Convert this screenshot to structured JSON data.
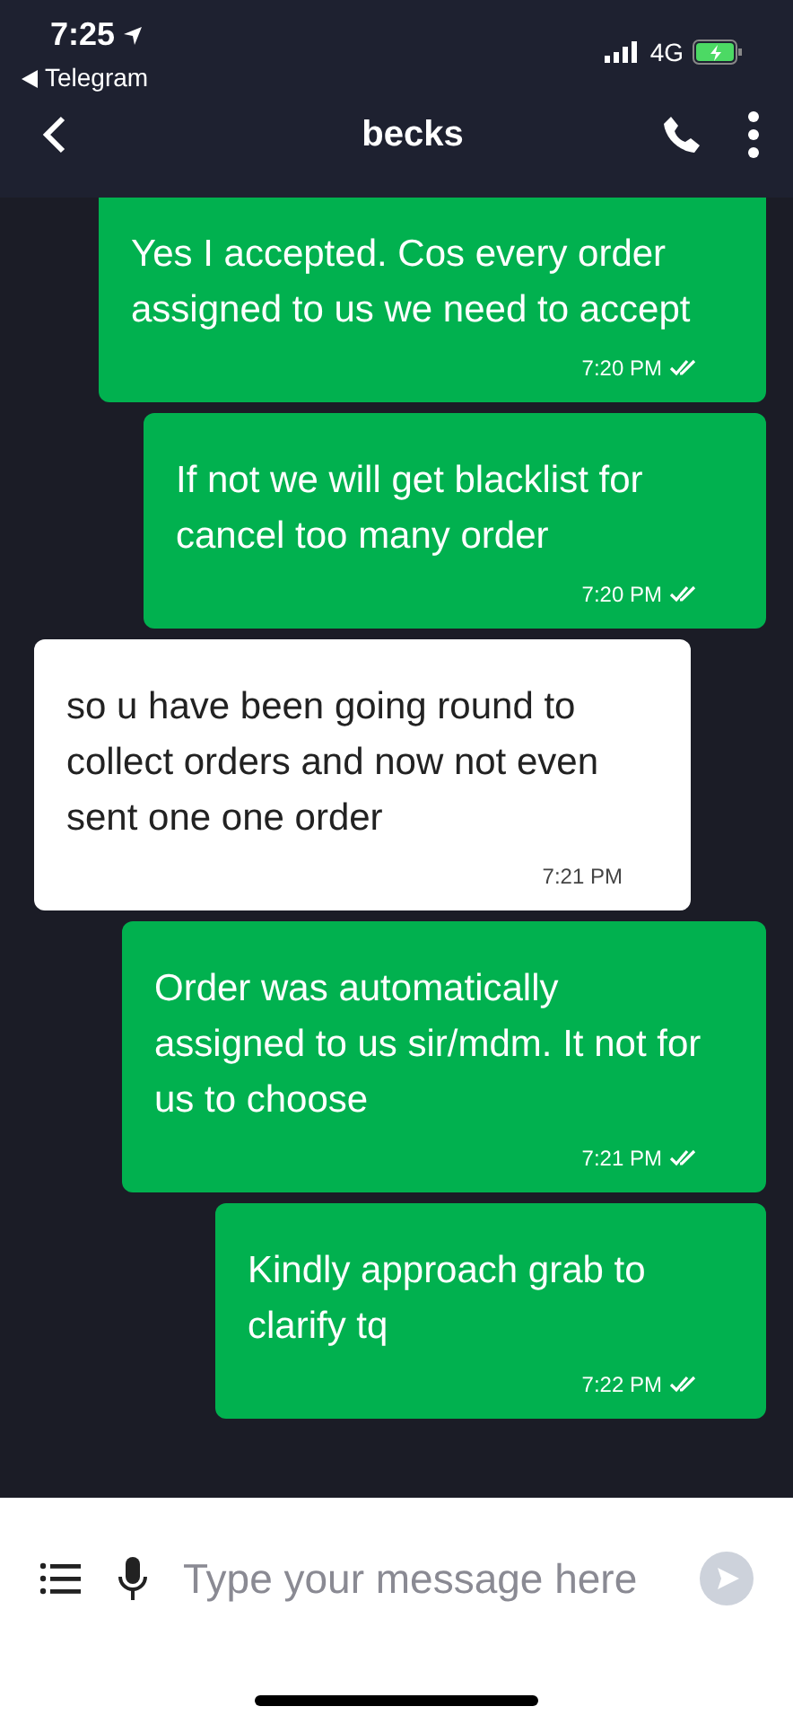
{
  "status_bar": {
    "time": "7:25",
    "back_app": "Telegram",
    "network": "4G"
  },
  "header": {
    "title": "becks"
  },
  "messages": [
    {
      "text": "Yes I accepted. Cos every order assigned to us we need to accept",
      "time": "7:20 PM",
      "outgoing": true,
      "read": true
    },
    {
      "text": "If not we will get blacklist for cancel too many order",
      "time": "7:20 PM",
      "outgoing": true,
      "read": true
    },
    {
      "text": "so u have been going round to collect orders and now not even sent one one order",
      "time": "7:21 PM",
      "outgoing": false,
      "read": false
    },
    {
      "text": "Order was automatically assigned to us sir/mdm. It not for us to choose",
      "time": "7:21 PM",
      "outgoing": true,
      "read": true
    },
    {
      "text": "Kindly approach grab to clarify tq",
      "time": "7:22 PM",
      "outgoing": true,
      "read": true
    }
  ],
  "composer": {
    "placeholder": "Type your message here"
  }
}
